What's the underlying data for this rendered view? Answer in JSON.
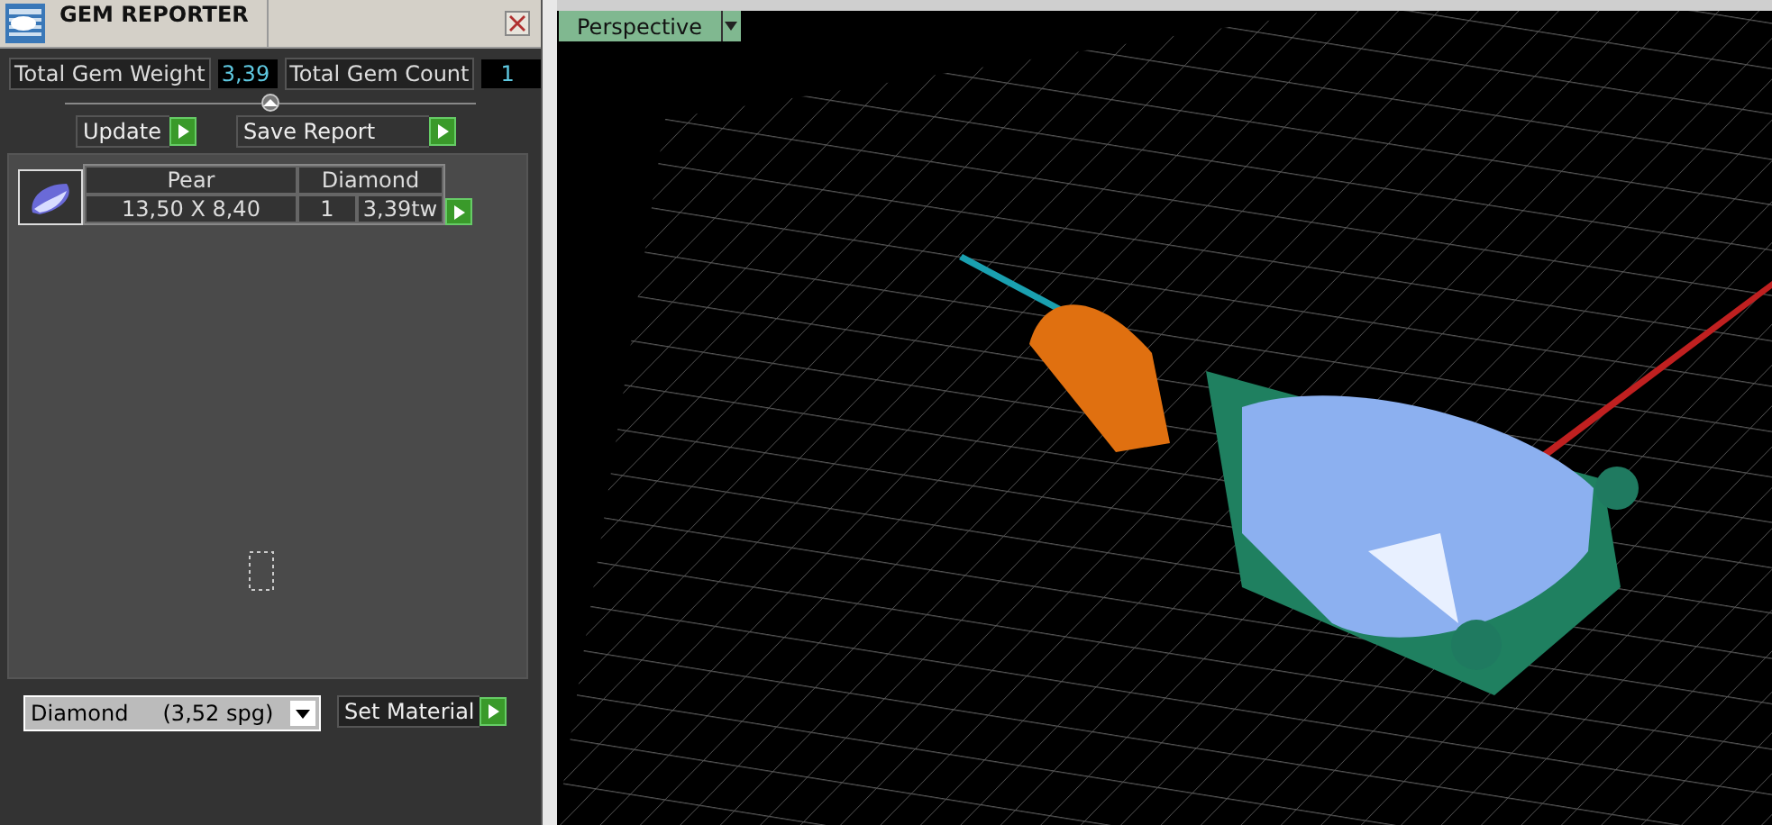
{
  "window": {
    "title": "GEM REPORTER"
  },
  "totals": [
    {
      "label": "Total Gem Weight",
      "value": "3,39"
    },
    {
      "label": "Total Gem Count",
      "value": "1"
    }
  ],
  "actions": [
    {
      "label": "Update"
    },
    {
      "label": "Save Report"
    }
  ],
  "gems": [
    {
      "shape": "Pear",
      "material": "Diamond",
      "size": "13,50 X 8,40",
      "count": "1",
      "weight": "3,39tw"
    }
  ],
  "material_select": {
    "value": "Diamond     (3,52 spg)"
  },
  "set_material": {
    "label": "Set Material"
  },
  "viewport": {
    "view_menu": "Perspective"
  }
}
